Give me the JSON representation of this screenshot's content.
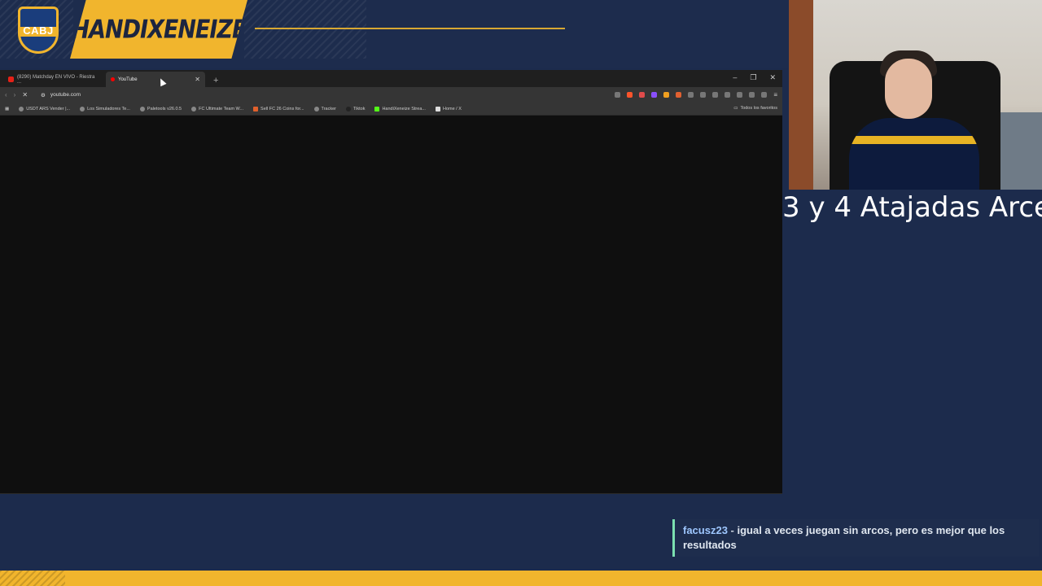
{
  "overlay": {
    "badge_text": "CABJ",
    "streamer_name": "HANDIXENEIZE",
    "caption": "3 y 4 Atajadas Arce"
  },
  "browser": {
    "tabs": [
      {
        "title": "(8290) Matchday EN VIVO - Riestra ...",
        "active": false
      },
      {
        "title": "YouTube",
        "active": true
      }
    ],
    "new_tab_label": "+",
    "window_controls": {
      "minimize": "–",
      "restore": "❐",
      "close": "✕"
    },
    "url": "youtube.com",
    "bookmarks": [
      "USDT ARS Vender |...",
      "Los Simuladores Te...",
      "Paletools v26.0.5",
      "FC Ultimate Team W...",
      "Sell FC 26 Coins for...",
      "Tracker",
      "Tiktok",
      "HandiXeneize Strea...",
      "Home / X"
    ],
    "all_bookmarks_label": "Todos los favoritos"
  },
  "chat": {
    "username": "facusz23",
    "separator": " - ",
    "message": "igual a veces juegan sin arcos, pero es mejor que los resultados"
  },
  "colors": {
    "gold": "#f1b52d",
    "navy": "#1c2b4c",
    "browser_bg": "#0f0f0f"
  }
}
